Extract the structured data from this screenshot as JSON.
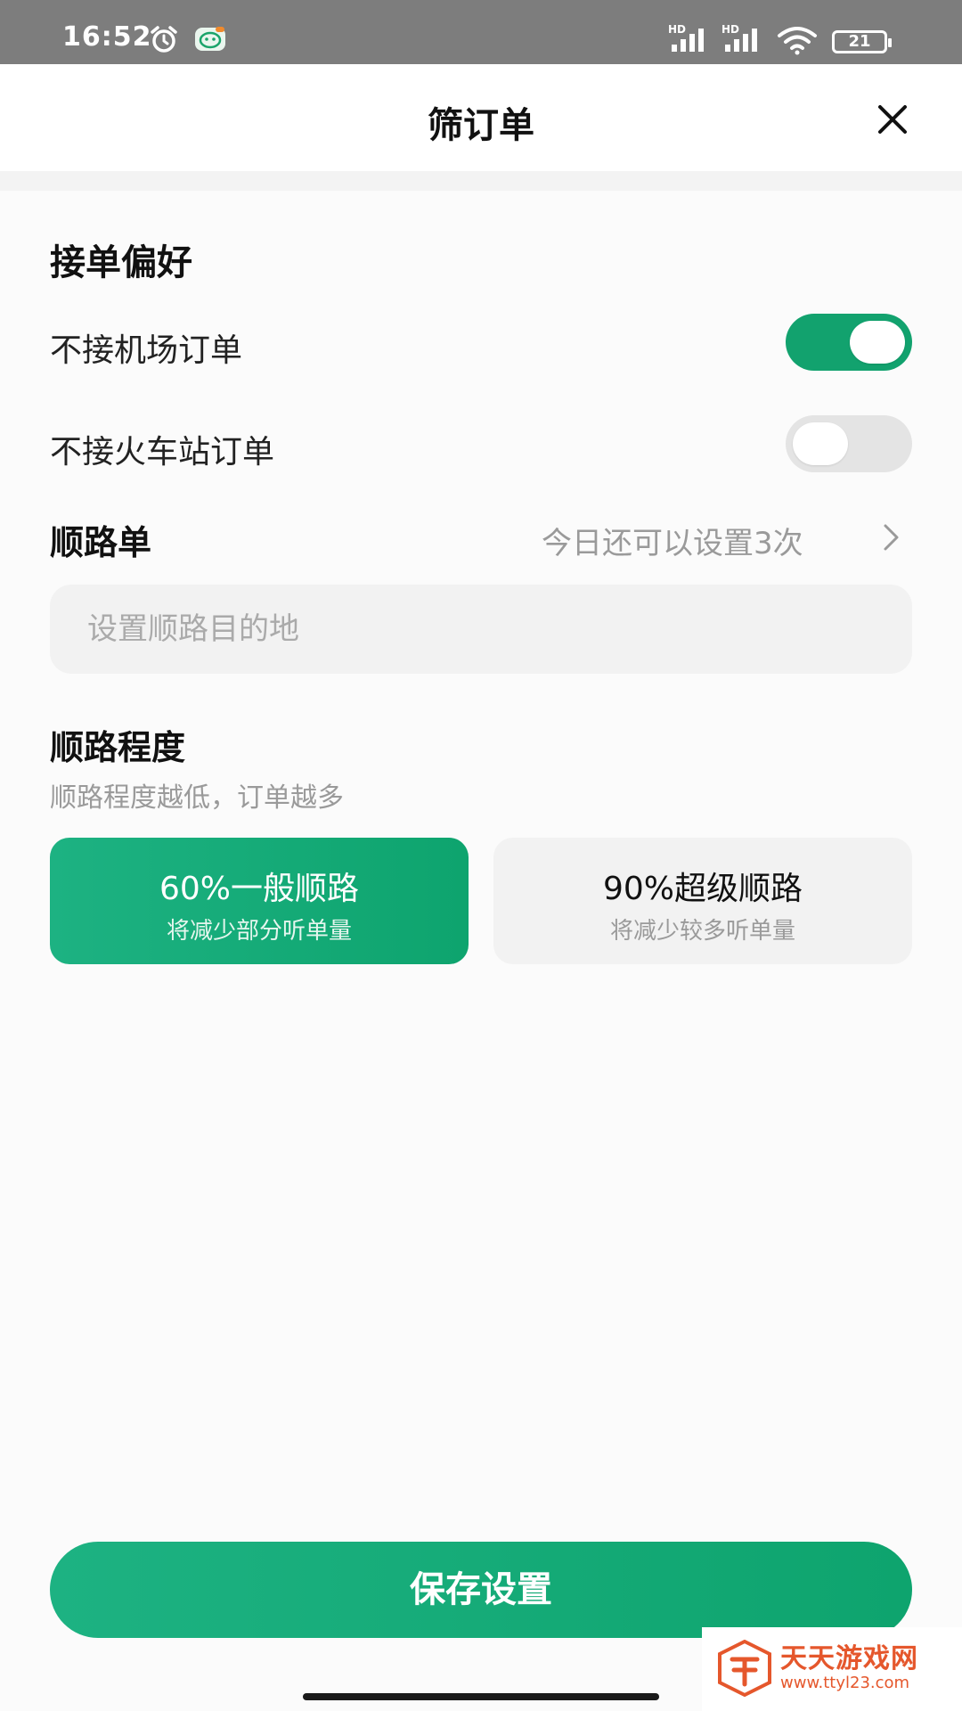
{
  "status_bar": {
    "time": "16:52",
    "signal_label_1": "HD",
    "signal_label_2": "HD",
    "battery": "21",
    "icons": [
      "alarm-icon",
      "app-icon",
      "signal-icon",
      "signal-icon",
      "wifi-icon",
      "battery-icon"
    ]
  },
  "header": {
    "title": "筛订单",
    "close_icon": "close-icon"
  },
  "preferences": {
    "section_title": "接单偏好",
    "toggles": [
      {
        "label": "不接机场订单",
        "state": "on"
      },
      {
        "label": "不接火车站订单",
        "state": "off"
      }
    ]
  },
  "route_order": {
    "title": "顺路单",
    "limit_text": "今日还可以设置3次",
    "chevron_icon": "chevron-right-icon",
    "destination_placeholder": "设置顺路目的地"
  },
  "route_degree": {
    "title": "顺路程度",
    "description": "顺路程度越低，订单越多",
    "options": [
      {
        "title": "60%一般顺路",
        "subtitle": "将减少部分听单量",
        "selected": true
      },
      {
        "title": "90%超级顺路",
        "subtitle": "将减少较多听单量",
        "selected": false
      }
    ]
  },
  "save_button": "保存设置",
  "colors": {
    "accent": "#12a26e",
    "status_bar": "#7d7d7d",
    "watermark": "#e5572c"
  },
  "watermark": {
    "name": "天天游戏网",
    "url": "www.ttyl23.com"
  }
}
